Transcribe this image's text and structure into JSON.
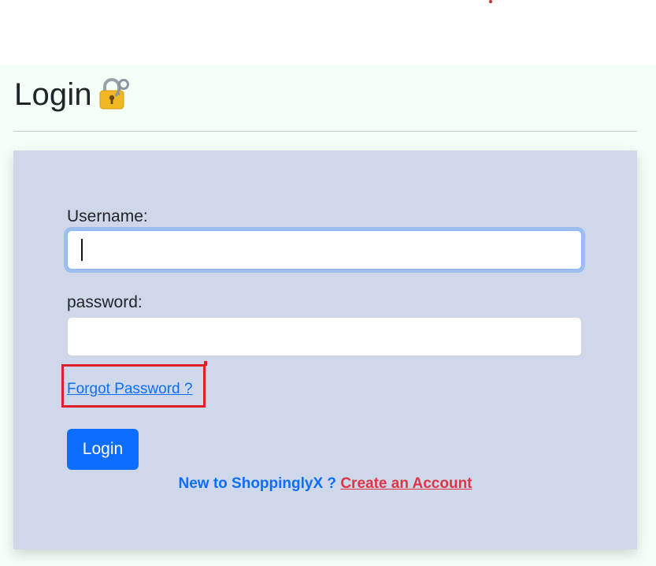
{
  "header": {
    "title": "Login"
  },
  "form": {
    "username_label": "Username:",
    "username_value": "",
    "password_label": "password:",
    "password_value": "",
    "forgot_password_label": "Forgot Password ?",
    "login_button_label": "Login"
  },
  "signup": {
    "prompt": "New to ShoppinglyX ?",
    "link_label": "Create an Account"
  },
  "icons": {
    "lock": "locked-with-key-icon"
  },
  "colors": {
    "primary": "#0d6efd",
    "danger": "#dc3545",
    "card_background": "#cfd8ea",
    "page_background": "#f4fff8",
    "annotation": "#e01e25"
  }
}
